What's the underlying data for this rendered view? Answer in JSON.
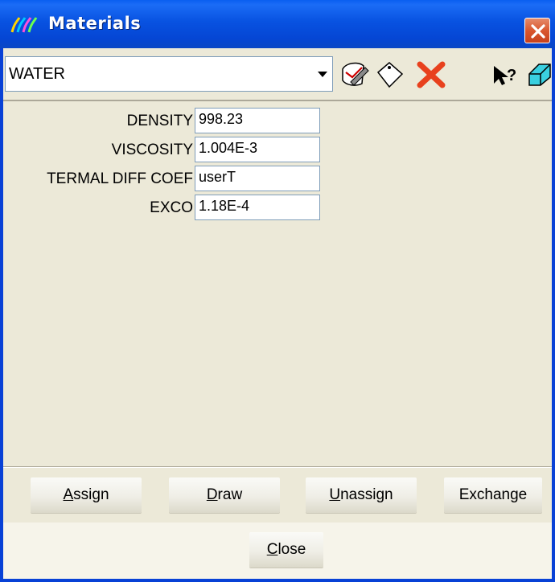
{
  "window": {
    "title": "Materials"
  },
  "toolbar": {
    "material_value": "WATER",
    "icons": [
      "edit-note-icon",
      "tag-icon",
      "delete-x-icon",
      "whats-this-help-icon",
      "eraser-icon"
    ]
  },
  "properties": [
    {
      "label": "DENSITY",
      "value": "998.23"
    },
    {
      "label": "VISCOSITY",
      "value": "1.004E-3"
    },
    {
      "label": "TERMAL DIFF COEF",
      "value": "userT"
    },
    {
      "label": "EXCO",
      "value": "1.18E-4"
    }
  ],
  "buttons": {
    "assign": {
      "first": "A",
      "rest": "ssign"
    },
    "draw": {
      "first": "D",
      "rest": "raw"
    },
    "unassign": {
      "first": "U",
      "rest": "nassign"
    },
    "exchange": "Exchange",
    "close": {
      "first": "C",
      "rest": "lose"
    }
  },
  "colors": {
    "titlebar": "#0852e1",
    "close_button": "#d9572f",
    "background": "#ece9d8"
  }
}
